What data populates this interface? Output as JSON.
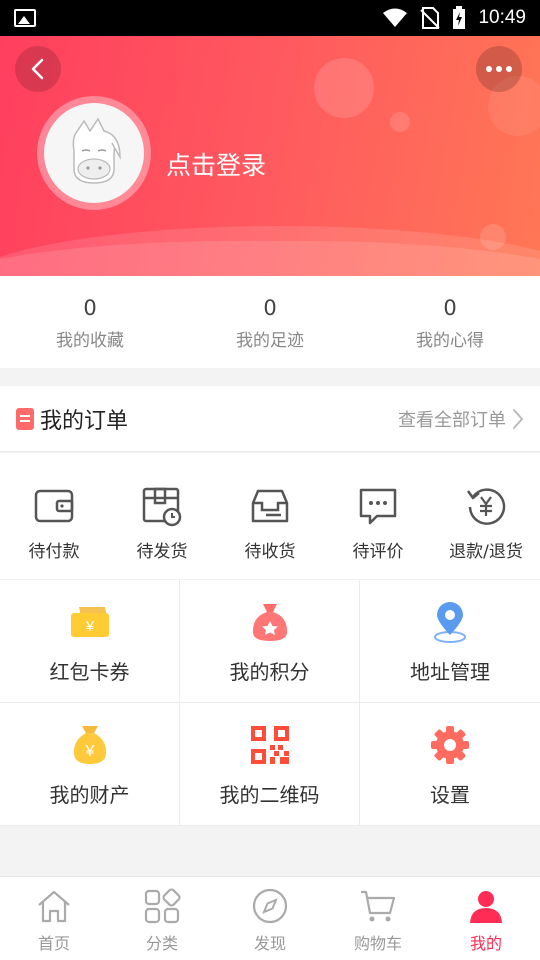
{
  "status_bar": {
    "time": "10:49"
  },
  "profile": {
    "login_text": "点击登录"
  },
  "stats": [
    {
      "value": "0",
      "label": "我的收藏"
    },
    {
      "value": "0",
      "label": "我的足迹"
    },
    {
      "value": "0",
      "label": "我的心得"
    }
  ],
  "orders": {
    "title": "我的订单",
    "view_all": "查看全部订单",
    "items": [
      {
        "label": "待付款",
        "icon": "wallet-icon"
      },
      {
        "label": "待发货",
        "icon": "package-clock-icon"
      },
      {
        "label": "待收货",
        "icon": "inbox-icon"
      },
      {
        "label": "待评价",
        "icon": "comment-icon"
      },
      {
        "label": "退款/退货",
        "icon": "refund-icon"
      }
    ]
  },
  "services": [
    {
      "label": "红包卡券",
      "icon": "coupon-icon"
    },
    {
      "label": "我的积分",
      "icon": "points-bag-icon"
    },
    {
      "label": "地址管理",
      "icon": "location-pin-icon"
    },
    {
      "label": "我的财产",
      "icon": "money-bag-icon"
    },
    {
      "label": "我的二维码",
      "icon": "qr-code-icon"
    },
    {
      "label": "设置",
      "icon": "settings-gear-icon"
    }
  ],
  "bottom_nav": [
    {
      "label": "首页",
      "icon": "home-icon"
    },
    {
      "label": "分类",
      "icon": "category-icon"
    },
    {
      "label": "发现",
      "icon": "compass-icon"
    },
    {
      "label": "购物车",
      "icon": "cart-icon"
    },
    {
      "label": "我的",
      "icon": "user-icon",
      "active": true
    }
  ],
  "colors": {
    "accent": "#ff2d55",
    "header_start": "#ff3f5e",
    "header_end": "#ff7755"
  }
}
